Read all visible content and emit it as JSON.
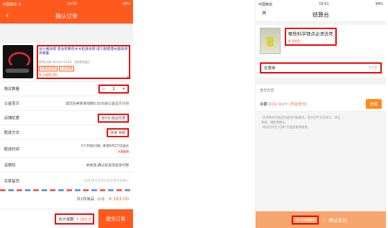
{
  "left": {
    "status": {
      "carrier": "中国移动 令",
      "time": "14:56",
      "battery": "98%"
    },
    "header": {
      "title": "确认订单"
    },
    "product": {
      "title": "浴小猪泳镜 高清防雾防水大框游泳镜 成人眼镜潜水面罩游泳装备",
      "spec": "颜色分类:M218+S338 【送收纳盒】",
      "tags": [
        "天猫无忧购",
        "七天退换"
      ],
      "price": "¥ 168.00",
      "qty": "x1"
    },
    "rows": {
      "quantity_label": "购买数量",
      "quantity_value": "1",
      "charity_label": "公益宝贝",
      "charity_value": "成交后卖家将捐赠0.02元给公益宝贝计划",
      "shop_promo_label": "店铺优惠",
      "shop_promo_value": "省5元:组合优惠",
      "delivery_label": "配送方式",
      "delivery_value": "快递 免邮",
      "delivery_time_label": "配送时间",
      "delivery_time_value": "17:00前付款, 承诺9月27日送达",
      "delivery_time_tag": "天猫速递",
      "insurance_label": "运费险",
      "insurance_value": "卖家送,确认收货前退货可赔",
      "message_label": "买家留言:",
      "message_placeholder": "选填:填写内容已和卖家协商确认"
    },
    "summary": {
      "count": "共1件商品",
      "subtotal_label": "小计:",
      "subtotal": "¥ 163.00"
    },
    "footer": {
      "total_label": "合计金额:",
      "total": "¥ 163.0",
      "submit": "提交订单"
    }
  },
  "right": {
    "status": {
      "carrier": "中国移动",
      "time": "15:01",
      "battery": "94%"
    },
    "header": {
      "title": "结算台"
    },
    "product": {
      "title": "哪些科学观点必须去死",
      "price": "8.99元"
    },
    "coupon": {
      "label": "优惠券",
      "value": "无可用"
    },
    "pay": {
      "label": "支付方式:",
      "balance_label": "余额",
      "balance": "4.02",
      "balance_unit": "阅读币",
      "insufficient": "(不足支付)",
      "topup": "充值"
    },
    "notes": [
      "•您将购买的商品为虚拟内容服务，购买后不支持退订、转让、",
      "退换，请酌情确认。",
      "•购买后可在\"已购\"页面查看和使用。"
    ],
    "footer": {
      "amount": "¥8.99阅读币",
      "confirm": "确认支付"
    }
  }
}
